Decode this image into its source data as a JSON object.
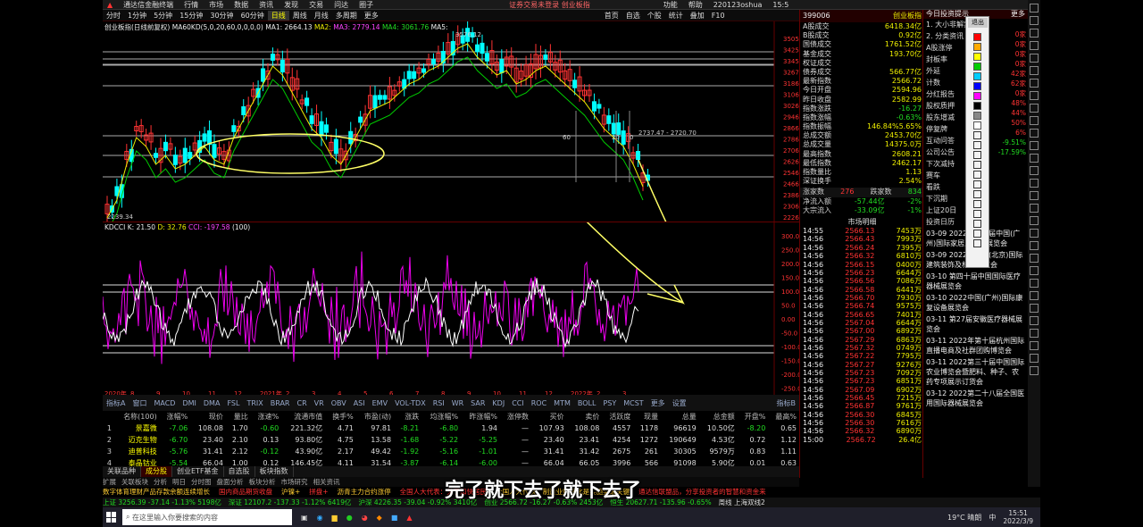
{
  "window": {
    "title": "通达信金融终端",
    "menus": [
      "行情",
      "市场",
      "数据",
      "资讯",
      "发现",
      "交易",
      "问达",
      "圈子"
    ],
    "right_notice": "证券交易未登录 创业板指",
    "right_menus": [
      "功能",
      "帮助"
    ],
    "account": "220123oshua",
    "time": "15:5"
  },
  "toolbar": {
    "periods": [
      "分时",
      "1分钟",
      "5分钟",
      "15分钟",
      "30分钟",
      "60分钟",
      "日线",
      "周线",
      "月线",
      "多周期",
      "更多"
    ],
    "right_tools": [
      "首页",
      "自选",
      "个股",
      "统计",
      "叠加",
      "F10"
    ],
    "main_indicator": "创业板指(日线前复权)",
    "ma_label": "MA60KD(5,0,20,60,0,0,0,0)",
    "ma1": "MA1: 2664.13",
    "ma2": "MA2: ",
    "ma3": "MA3: 2779.14",
    "ma4": "MA4: 3061.76",
    "ma5": "MA5: ",
    "ma7": "MA7 : ",
    "ma8": "MA8 : "
  },
  "chart_data": [
    {
      "type": "candlestick",
      "y_ticks": [
        "3505",
        "3425",
        "3345",
        "3267",
        "3186",
        "3106",
        "3026",
        "2946",
        "2866",
        "2786",
        "2706",
        "2626",
        "2546",
        "2466",
        "2386",
        "2306",
        "2226"
      ],
      "high_label": "3576.12",
      "low_label": "2239.34",
      "range_label": "2737.47 - 2720.70",
      "annotations": [
        "60",
        "20",
        "0"
      ],
      "marks": [
        "2",
        "3",
        "4"
      ]
    },
    {
      "type": "line",
      "title": "KDCCI K: 21.50",
      "d_label": "D: 32.76",
      "cci_label": "CCI: -197.58",
      "param": "(100)",
      "y_ticks": [
        "300.0",
        "250.0",
        "200.0",
        "150.0",
        "100.0",
        "50.0",
        "0.00",
        "-50.0",
        "-100.0",
        "-150.0",
        "-200.0",
        "-250.0"
      ]
    }
  ],
  "tabs": [
    "指标A",
    "窗口",
    "MACD",
    "DMI",
    "DMA",
    "FSL",
    "TRIX",
    "BRAR",
    "CR",
    "VR",
    "OBV",
    "ASI",
    "EMV",
    "VOL-TDX",
    "RSI",
    "WR",
    "SAR",
    "KDJ",
    "CCI",
    "ROC",
    "MTM",
    "BOLL",
    "PSY",
    "MCST",
    "更多",
    "设置"
  ],
  "tabs_right": "指标B",
  "x_labels": [
    "2020年",
    "8",
    "9",
    "10",
    "11",
    "12",
    "2021年",
    "2",
    "3",
    "4",
    "5",
    "6",
    "7",
    "8",
    "9",
    "10",
    "11",
    "12",
    "2022年",
    "2",
    "3"
  ],
  "table": {
    "headers": [
      "",
      "名称(100)",
      "涨幅%",
      "现价",
      "量比",
      "涨速%",
      "流通市值",
      "换手%",
      "市盈(动)",
      "涨跌",
      "均涨幅%",
      "昨涨幅%",
      "涨停数",
      "买价",
      "卖价",
      "活跃度",
      "现量",
      "总量",
      "总金额",
      "开盘%",
      "最高%"
    ],
    "rows": [
      [
        "1",
        "景嘉微",
        "-7.06",
        "108.08",
        "1.70",
        "-0.60",
        "221.32亿",
        "4.71",
        "97.81",
        "-8.21",
        "-6.80",
        "1.94",
        "—",
        "107.93",
        "108.08",
        "4557",
        "1178",
        "96619",
        "10.50亿",
        "-8.20",
        "0.65"
      ],
      [
        "2",
        "迈克生物",
        "-6.70",
        "23.40",
        "2.10",
        "0.13",
        "93.80亿",
        "4.75",
        "13.58",
        "-1.68",
        "-5.22",
        "-5.25",
        "—",
        "23.40",
        "23.41",
        "4254",
        "1272",
        "190649",
        "4.53亿",
        "0.72",
        "1.12"
      ],
      [
        "3",
        "迪普科技",
        "-5.76",
        "31.41",
        "2.12",
        "-0.12",
        "43.90亿",
        "2.17",
        "49.42",
        "-1.92",
        "-5.16",
        "-1.01",
        "—",
        "31.41",
        "31.42",
        "2675",
        "261",
        "30305",
        "9579万",
        "0.83",
        "1.11"
      ],
      [
        "4",
        "泰晶钴业",
        "-5.54",
        "66.04",
        "1.00",
        "0.12",
        "146.45亿",
        "4.11",
        "31.54",
        "-3.87",
        "-6.14",
        "-6.00",
        "—",
        "66.04",
        "66.05",
        "3996",
        "566",
        "91098",
        "5.90亿",
        "0.01",
        "0.63"
      ]
    ]
  },
  "bottom_tabs": [
    "关联品种",
    "成分股",
    "创业ETF基金",
    "自选股",
    "板块指数"
  ],
  "bottom_tabs2": [
    "扩展",
    "关联板块",
    "分析",
    "明日",
    "分时图",
    "盘面分析",
    "板块分析",
    "市场研究",
    "相关资讯"
  ],
  "rpanel": {
    "code": "399006",
    "name": "创业板指",
    "stats": [
      [
        "A股成交",
        "6418.34亿"
      ],
      [
        "B股成交",
        "0.92亿"
      ],
      [
        "国债成交",
        "1761.52亿"
      ],
      [
        "基金成交",
        "193.70亿"
      ],
      [
        "权证成交",
        ""
      ],
      [
        "债券成交",
        "566.77亿"
      ],
      [
        "最新指数",
        "2566.72"
      ],
      [
        "今日开盘",
        "2594.96"
      ],
      [
        "昨日收盘",
        "2582.99"
      ],
      [
        "指数涨跌",
        "-16.27"
      ],
      [
        "指数涨幅",
        "-0.63%"
      ],
      [
        "指数振幅",
        "146.84%5.65%"
      ],
      [
        "总成交额",
        "2453.70亿"
      ],
      [
        "总成交量",
        "14375.0万"
      ],
      [
        "最高指数",
        "2608.21"
      ],
      [
        "最低指数",
        "2462.17"
      ],
      [
        "指数量比",
        "1.13"
      ],
      [
        "深证换手",
        "2.54%"
      ]
    ],
    "updown": [
      "涨家数",
      "276",
      "跌家数",
      "834"
    ],
    "flows": [
      [
        "净流入额",
        "-57.44亿",
        "-2%"
      ],
      [
        "大宗流入",
        "-33.09亿",
        "-1%"
      ]
    ],
    "market_depth_title": "市场明细",
    "ticks": [
      [
        "14:55",
        "2566.13",
        "7453万"
      ],
      [
        "14:56",
        "2566.43",
        "7993万"
      ],
      [
        "14:56",
        "2566.24",
        "7395万"
      ],
      [
        "14:56",
        "2566.32",
        "6810万"
      ],
      [
        "14:56",
        "2566.15",
        "0400万"
      ],
      [
        "14:56",
        "2566.23",
        "6644万"
      ],
      [
        "14:56",
        "2566.56",
        "7086万"
      ],
      [
        "14:56",
        "2566.58",
        "6441万"
      ],
      [
        "14:56",
        "2566.70",
        "7930万"
      ],
      [
        "14:56",
        "2566.74",
        "9575万"
      ],
      [
        "14:56",
        "2566.65",
        "7401万"
      ],
      [
        "14:56",
        "2567.04",
        "6644万"
      ],
      [
        "14:56",
        "2567.00",
        "6892万"
      ],
      [
        "14:56",
        "2567.29",
        "6863万"
      ],
      [
        "14:56",
        "2567.32",
        "0749万"
      ],
      [
        "14:56",
        "2567.22",
        "7795万"
      ],
      [
        "14:56",
        "2567.27",
        "9276万"
      ],
      [
        "14:56",
        "2567.23",
        "7092万"
      ],
      [
        "14:56",
        "2567.23",
        "6851万"
      ],
      [
        "14:56",
        "2567.09",
        "6902万"
      ],
      [
        "14:56",
        "2566.45",
        "7215万"
      ],
      [
        "14:56",
        "2566.87",
        "9761万"
      ],
      [
        "14:56",
        "2566.30",
        "6845万"
      ],
      [
        "14:56",
        "2566.30",
        "7616万"
      ],
      [
        "14:56",
        "2566.32",
        "6890万"
      ],
      [
        "15:00",
        "2566.72",
        "26.4亿"
      ]
    ]
  },
  "news": {
    "header": "今日投资提示",
    "more": "更多",
    "items": [
      "1. 大小非解禁",
      "2. 分类资讯",
      "A股涨停",
      "封板率",
      "外延",
      "计数",
      "分红报告",
      "股权质押",
      "股东增减",
      "停复牌",
      "互动问答",
      "公司公告",
      "下次减持",
      "赛车",
      "看跌",
      "下沉期",
      "上证20日",
      "投资日历",
      "03-09 2022年第三届中国(广州)国际家居及地产展览会",
      "03-09 2022年中国(北京)国际建筑装饰及材料博览会",
      "03-10 第四十届中国国际医疗器械展览会",
      "03-10 2022中国(广州)国际康复设备展览会",
      "03-11 第27届安徽医疗器械展览会",
      "03-11 2022年第十届杭州国际直播电商及社群团购博览会",
      "03-11 2022第三十届中国国际农业博览会暨肥料、种子、农药专项展示订货会",
      "03-12 2022第二十八届全国医用国际器械展览会"
    ],
    "right_labels": [
      "0家",
      "0家",
      "0家",
      "0家",
      "42家",
      "62家",
      "0家",
      "48%",
      "44%",
      "50%",
      "6%",
      "-9.51%",
      "-17.59%"
    ]
  },
  "ticker": [
    "数字体育理财产品存款余额连续增长",
    "国内商品期货收盘",
    "沪镍+",
    "拼盘+",
    "沥青主力合约涨停",
    "全国人大代表：关于加快居民",
    "全国人大代表：制造业数智化是实施突破关键",
    "通达信联盟品，分享投资者的智慧和资金来"
  ],
  "status": {
    "sh": "上证 3256.39 -37.14 -1.13% 5198亿",
    "sz": "深证 12107.2 -137.33 -1.12% 6419亿",
    "hs300": "沪深 4226.35 -39.04 -0.92% 3410亿",
    "chuang": "创业 2566.72 -16.27 -0.63% 2453亿",
    "hk": "恒生 20627.71 -135.96 -0.65%",
    "right": "周线 上海双线2"
  },
  "taskbar": {
    "search": "在这里输入你要搜索的内容",
    "weather": "19°C 晴朗",
    "clock": "15:51",
    "date": "2022/3/9",
    "lang": "中"
  },
  "subtitle": "完了就下去了就下去了",
  "popup": {
    "close": "退出"
  }
}
